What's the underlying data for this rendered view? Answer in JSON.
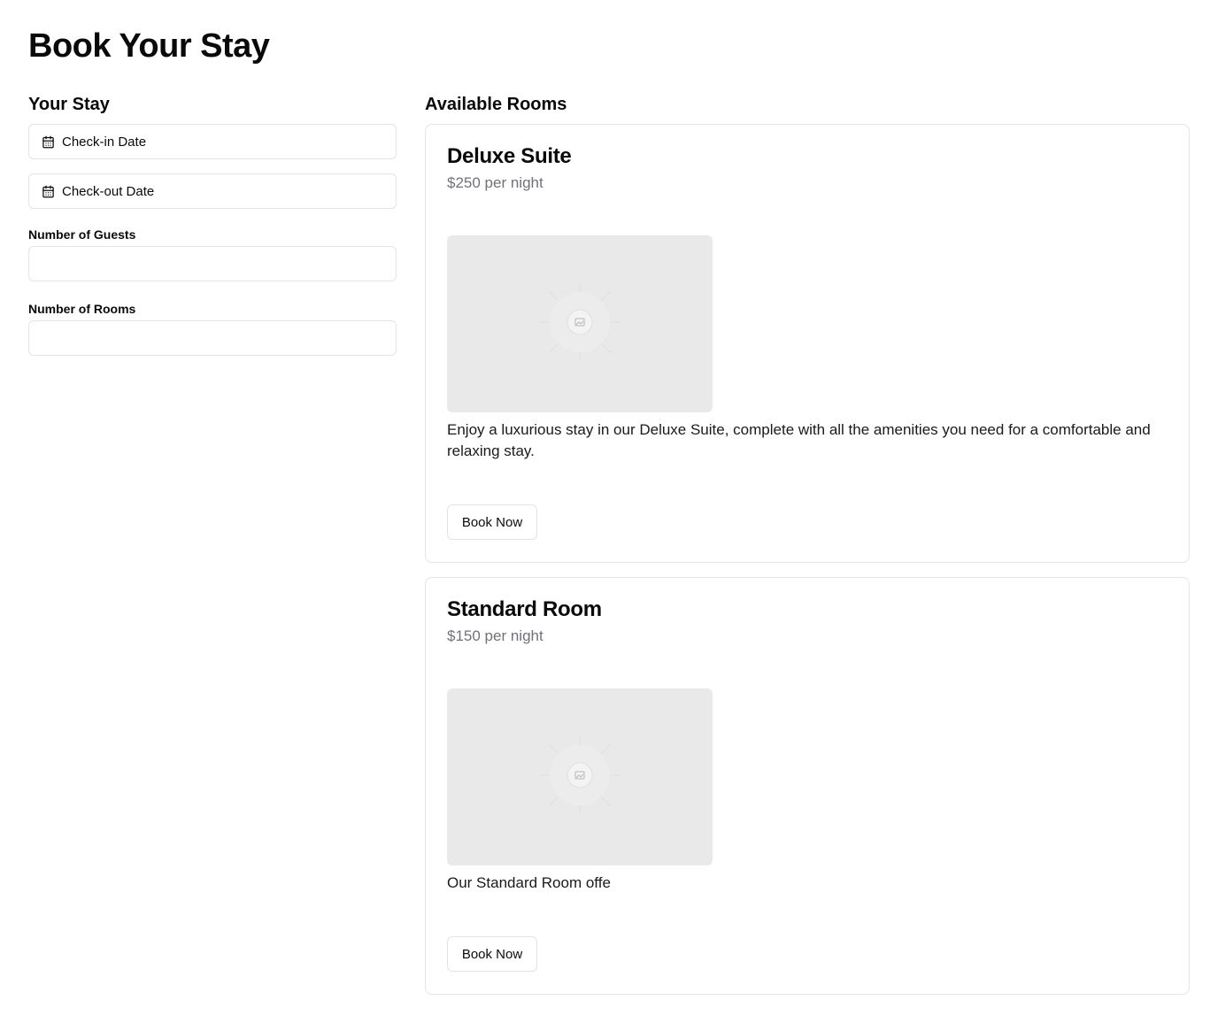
{
  "page": {
    "title": "Book Your Stay"
  },
  "sidebar": {
    "title": "Your Stay",
    "check_in_label": "Check-in Date",
    "check_out_label": "Check-out Date",
    "guests_label": "Number of Guests",
    "guests_value": "",
    "rooms_label": "Number of Rooms",
    "rooms_value": "",
    "date_icon": "calendar-icon"
  },
  "main": {
    "title": "Available Rooms",
    "rooms": [
      {
        "name": "Deluxe Suite",
        "price": "$250 per night",
        "image_icon": "image-placeholder-icon",
        "description": "Enjoy a luxurious stay in our Deluxe Suite, complete with all the amenities you need for a comfortable and relaxing stay.",
        "button_label": "Book Now"
      },
      {
        "name": "Standard Room",
        "price": "$150 per night",
        "image_icon": "image-placeholder-icon",
        "description": "Our Standard Room offe",
        "button_label": "Book Now"
      }
    ]
  },
  "colors": {
    "border": "#e4e4e7",
    "muted_text": "#71717a",
    "image_placeholder_bg": "#e9e9e9"
  }
}
